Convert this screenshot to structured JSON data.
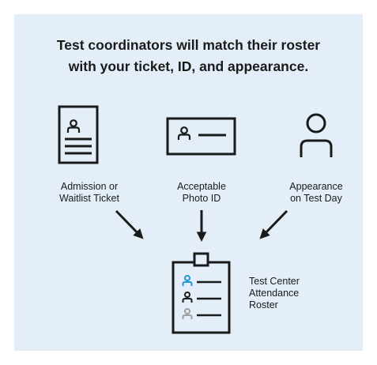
{
  "headline": {
    "line1": "Test coordinators will match their roster",
    "line2": "with your ticket, ID, and appearance."
  },
  "items": [
    {
      "icon": "document-ticket-icon",
      "line1": "Admission or",
      "line2": "Waitlist Ticket"
    },
    {
      "icon": "photo-id-card-icon",
      "line1": "Acceptable",
      "line2": "Photo ID"
    },
    {
      "icon": "person-icon",
      "line1": "Appearance",
      "line2": "on Test Day"
    }
  ],
  "roster": {
    "icon": "clipboard-roster-icon",
    "line1": "Test Center",
    "line2": "Attendance",
    "line3": "Roster"
  },
  "colors": {
    "panel_background": "#e3eef8",
    "ink": "#1a1a1a",
    "accent_blue": "#2196d3",
    "muted_gray": "#9e9e9e"
  }
}
